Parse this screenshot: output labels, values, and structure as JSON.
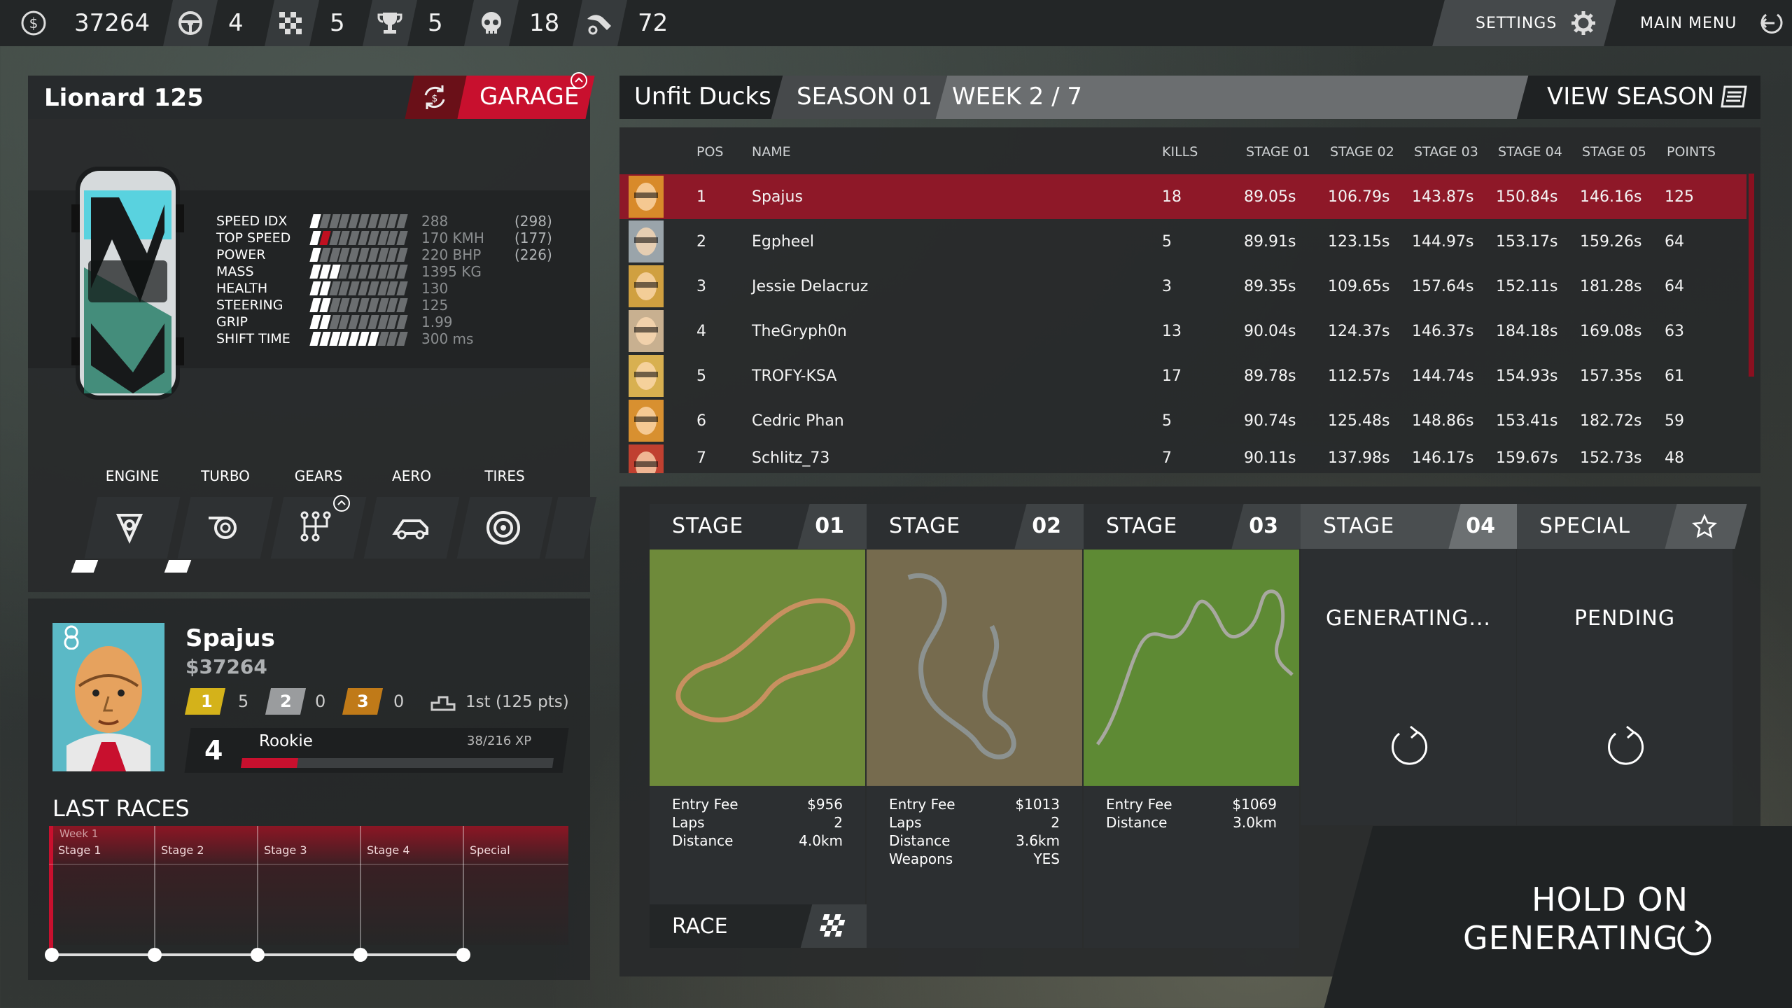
{
  "topbar": {
    "money": "37264",
    "cars": "4",
    "races": "5",
    "trophies": "5",
    "kills": "18",
    "wrecks": "72",
    "settings_label": "SETTINGS",
    "main_menu_label": "MAIN MENU"
  },
  "car": {
    "name": "Lionard 125",
    "garage_label": "GARAGE",
    "stats": [
      {
        "label": "SPEED IDX",
        "value": "288",
        "extra": "(298)",
        "level": 0.1
      },
      {
        "label": "TOP SPEED",
        "value": "170 KMH",
        "extra": "(177)",
        "level": 0.15
      },
      {
        "label": "POWER",
        "value": "220 BHP",
        "extra": "(226)",
        "level": 0.1
      },
      {
        "label": "MASS",
        "value": "1395 KG",
        "extra": "",
        "level": 0.3
      },
      {
        "label": "HEALTH",
        "value": "130",
        "extra": "",
        "level": 0.2
      },
      {
        "label": "STEERING",
        "value": "125",
        "extra": "",
        "level": 0.2
      },
      {
        "label": "GRIP",
        "value": "1.99",
        "extra": "",
        "level": 0.2
      },
      {
        "label": "SHIFT TIME",
        "value": "300 ms",
        "extra": "",
        "level": 0.65
      }
    ],
    "upgrades": [
      "ENGINE",
      "TURBO",
      "GEARS",
      "AERO",
      "TIRES"
    ]
  },
  "driver": {
    "name": "Spajus",
    "money": "$37264",
    "badge_number": "8",
    "first_place": "1",
    "first_count": "5",
    "second_place": "2",
    "second_count": "0",
    "third_place": "3",
    "third_count": "0",
    "standing": "1st (125 pts)",
    "level": "4",
    "rank": "Rookie",
    "xp": "38/216 XP",
    "xp_fraction": 0.18
  },
  "last_races": {
    "title": "LAST RACES",
    "week": "Week 1",
    "columns": [
      "Stage 1",
      "Stage 2",
      "Stage 3",
      "Stage 4",
      "Special"
    ]
  },
  "season": {
    "team": "Unfit Ducks",
    "season": "SEASON 01",
    "week": "WEEK 2 / 7",
    "view_label": "VIEW SEASON",
    "headers": [
      "POS",
      "NAME",
      "KILLS",
      "STAGE 01",
      "STAGE 02",
      "STAGE 03",
      "STAGE 04",
      "STAGE 05",
      "POINTS"
    ],
    "rows": [
      {
        "pos": "1",
        "name": "Spajus",
        "kills": "18",
        "s1": "89.05s",
        "s2": "106.79s",
        "s3": "143.87s",
        "s4": "150.84s",
        "s5": "146.16s",
        "points": "125"
      },
      {
        "pos": "2",
        "name": "Egpheel",
        "kills": "5",
        "s1": "89.91s",
        "s2": "123.15s",
        "s3": "144.97s",
        "s4": "153.17s",
        "s5": "159.26s",
        "points": "64"
      },
      {
        "pos": "3",
        "name": "Jessie Delacruz",
        "kills": "3",
        "s1": "89.35s",
        "s2": "109.65s",
        "s3": "157.64s",
        "s4": "152.11s",
        "s5": "181.28s",
        "points": "64"
      },
      {
        "pos": "4",
        "name": "TheGryph0n",
        "kills": "13",
        "s1": "90.04s",
        "s2": "124.37s",
        "s3": "146.37s",
        "s4": "184.18s",
        "s5": "169.08s",
        "points": "63"
      },
      {
        "pos": "5",
        "name": "TROFY-KSA",
        "kills": "17",
        "s1": "89.78s",
        "s2": "112.57s",
        "s3": "144.74s",
        "s4": "154.93s",
        "s5": "157.35s",
        "points": "61"
      },
      {
        "pos": "6",
        "name": "Cedric Phan",
        "kills": "5",
        "s1": "90.74s",
        "s2": "125.48s",
        "s3": "148.86s",
        "s4": "153.41s",
        "s5": "182.72s",
        "points": "59"
      },
      {
        "pos": "7",
        "name": "Schlitz_73",
        "kills": "7",
        "s1": "90.11s",
        "s2": "137.98s",
        "s3": "146.17s",
        "s4": "159.67s",
        "s5": "152.73s",
        "points": "48"
      }
    ]
  },
  "stages": [
    {
      "title": "STAGE",
      "num": "01",
      "entry_label": "Entry Fee",
      "entry": "$956",
      "laps_label": "Laps",
      "laps": "2",
      "dist_label": "Distance",
      "dist": "4.0km",
      "race_label": "RACE"
    },
    {
      "title": "STAGE",
      "num": "02",
      "entry_label": "Entry Fee",
      "entry": "$1013",
      "laps_label": "Laps",
      "laps": "2",
      "dist_label": "Distance",
      "dist": "3.6km",
      "weap_label": "Weapons",
      "weap": "YES"
    },
    {
      "title": "STAGE",
      "num": "03",
      "entry_label": "Entry Fee",
      "entry": "$1069",
      "dist_label": "Distance",
      "dist": "3.0km"
    },
    {
      "title": "STAGE",
      "num": "04",
      "status": "GENERATING..."
    },
    {
      "title": "SPECIAL",
      "status": "PENDING"
    }
  ],
  "hold_on": {
    "line1": "HOLD ON",
    "line2": "GENERATING"
  },
  "colors": {
    "accent_red": "#c8102e",
    "gold": "#d4b21a",
    "silver": "#9a9c9e",
    "bronze": "#c07a18"
  }
}
